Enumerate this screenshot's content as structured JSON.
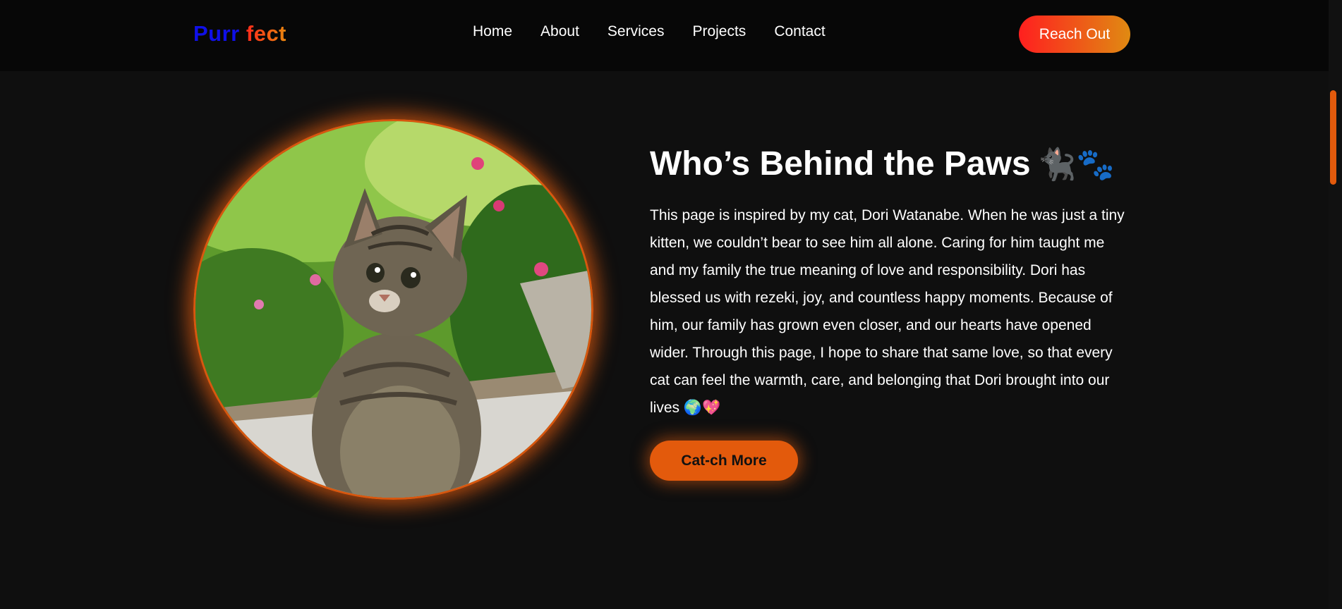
{
  "brand": {
    "part1": "Purr",
    "part2": "fect"
  },
  "nav": {
    "items": [
      "Home",
      "About",
      "Services",
      "Projects",
      "Contact"
    ],
    "cta_label": "Reach Out"
  },
  "about": {
    "heading": "Who’s Behind the Paws",
    "heading_emoji": "🐈‍⬛🐾",
    "paragraph": "This page is inspired by my cat, Dori Watanabe. When he was just a tiny kitten, we couldn’t bear to see him all alone. Caring for him taught me and my family the true meaning of love and responsibility. Dori has blessed us with rezeki, joy, and countless happy moments. Because of him, our family has grown even closer, and our hearts have opened wider. Through this page, I hope to share that same love, so that every cat can feel the warmth, care, and belonging that Dori brought into our lives 🌍💖",
    "button_label": "Cat-ch More",
    "image_icon": "tabby-cat-photo"
  },
  "colors": {
    "accent": "#e35a0c",
    "logo_blue": "#1010e8",
    "gradient_start": "#ff1f1f",
    "gradient_end": "#e08a12",
    "background": "#0f0f0f",
    "navbar": "#070707"
  }
}
